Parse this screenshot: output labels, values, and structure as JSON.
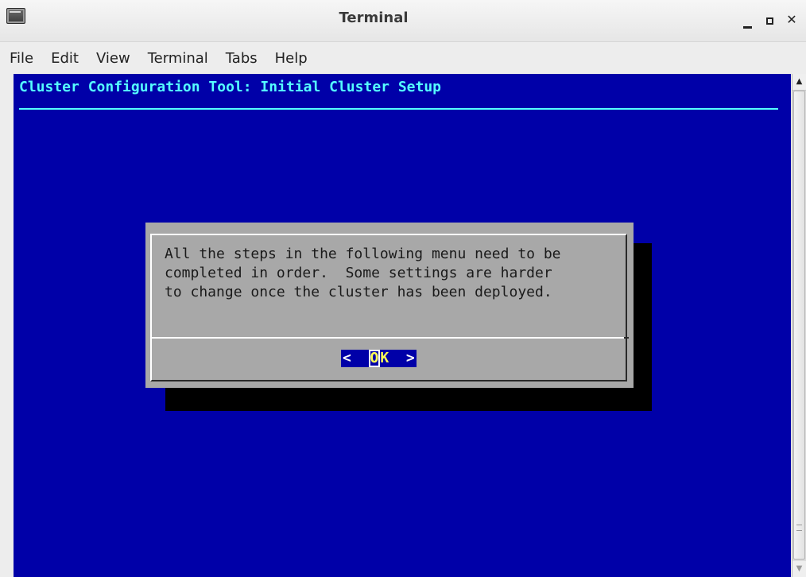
{
  "window": {
    "title": "Terminal"
  },
  "menu": {
    "items": [
      {
        "label": "File"
      },
      {
        "label": "Edit"
      },
      {
        "label": "View"
      },
      {
        "label": "Terminal"
      },
      {
        "label": "Tabs"
      },
      {
        "label": "Help"
      }
    ]
  },
  "terminal": {
    "header": "Cluster Configuration Tool: Initial Cluster Setup",
    "colors": {
      "background": "#0000a8",
      "header": "#55ffff",
      "dialog": "#a8a8a8",
      "button_highlight": "#ffff55"
    }
  },
  "dialog": {
    "lines": [
      "All the steps in the following menu need to be",
      "completed in order.  Some settings are harder",
      "to change once the cluster has been deployed."
    ],
    "ok_left": "<",
    "ok_first": "O",
    "ok_rest": "K",
    "ok_right": ">"
  },
  "icons": {
    "app": "terminal-icon",
    "minimize": "minimize-icon",
    "maximize": "maximize-icon",
    "close": "close-icon",
    "scroll_up": "arrow-up-icon",
    "scroll_down": "arrow-down-icon"
  }
}
